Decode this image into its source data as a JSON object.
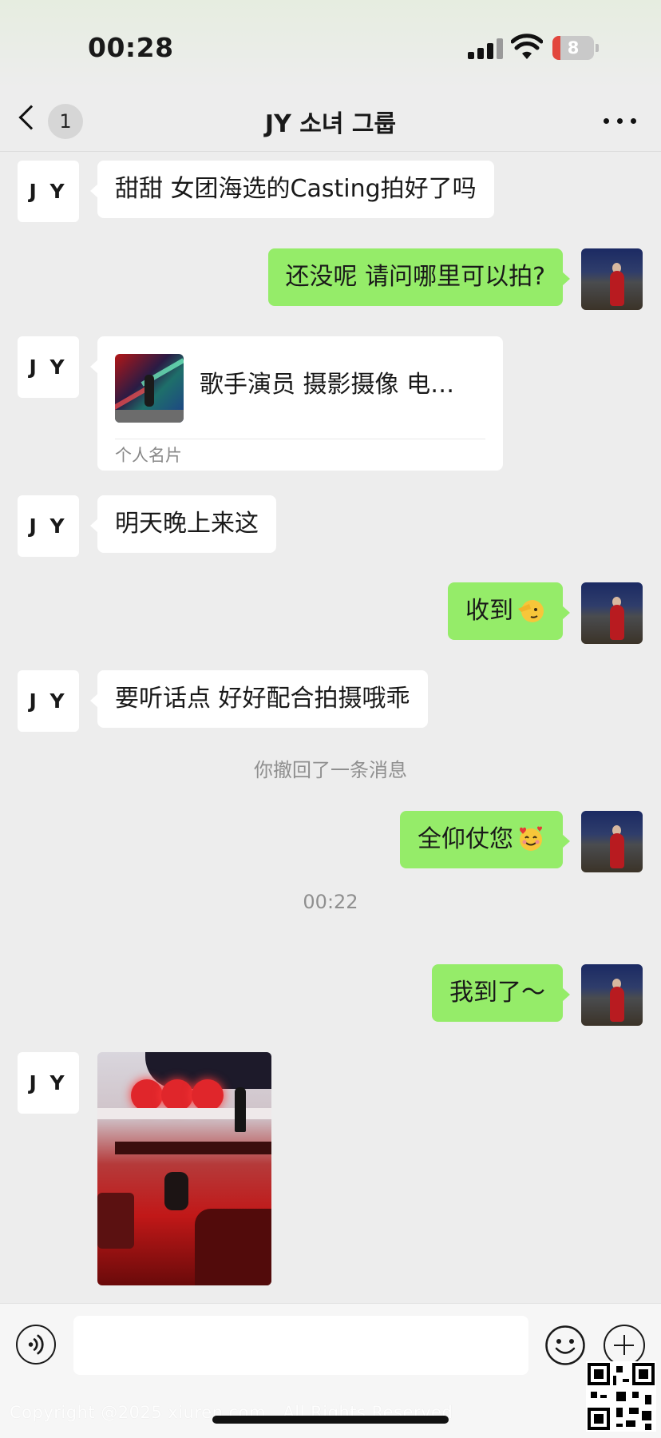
{
  "status_bar": {
    "time": "00:28",
    "battery_level": "8",
    "battery_fraction": 0.08
  },
  "nav": {
    "back_badge": "1",
    "title": "JY 소녀 그룹"
  },
  "contact": {
    "avatar_text": "J Y"
  },
  "messages": {
    "m1": "甜甜 女团海选的Casting拍好了吗",
    "m2": "还没呢 请问哪里可以拍?",
    "card_title": "歌手演员 摄影摄像 电…",
    "card_label": "个人名片",
    "m4": "明天晚上来这",
    "m5": "收到",
    "m6": "要听话点 好好配合拍摄哦乖",
    "recalled": "你撤回了一条消息",
    "m7": "全仰仗您",
    "timestamp": "00:22",
    "m8": "我到了～"
  },
  "input": {
    "placeholder": ""
  },
  "watermark": "Copyright @2025  xiuren.com , All Rights Reserved",
  "icons": {
    "back": "chevron-left-icon",
    "more": "more-dots-icon",
    "voice": "voice-icon",
    "emoji": "emoji-face-icon",
    "plus": "plus-icon",
    "emoji_m5": "saluting-face-emoji",
    "emoji_m7": "smiling-face-with-hearts-emoji"
  },
  "colors": {
    "background": "#ededed",
    "bubble_self": "#95ec69",
    "bubble_other": "#ffffff",
    "battery_low": "#e2463d"
  }
}
